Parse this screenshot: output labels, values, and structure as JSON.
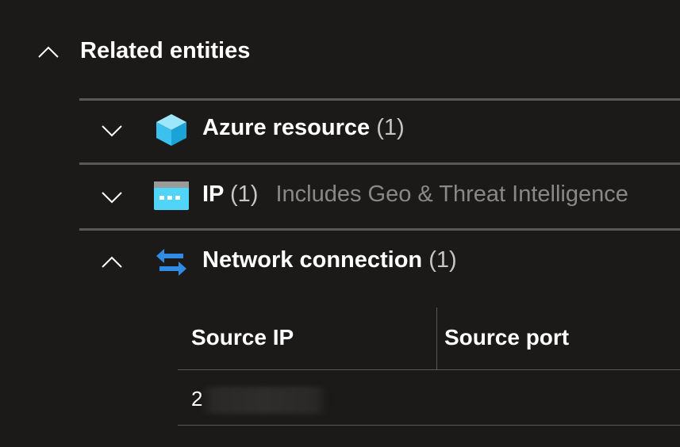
{
  "section": {
    "title": "Related entities",
    "expanded": true
  },
  "entities": [
    {
      "name": "Azure resource",
      "count": "(1)",
      "subtitle": "",
      "icon": "azure-cube-icon",
      "expanded": false
    },
    {
      "name": "IP",
      "count": "(1)",
      "subtitle": "Includes Geo & Threat Intelligence",
      "icon": "ip-window-icon",
      "expanded": false
    },
    {
      "name": "Network connection",
      "count": "(1)",
      "subtitle": "",
      "icon": "network-arrows-icon",
      "expanded": true
    }
  ],
  "network_table": {
    "columns": [
      "Source IP",
      "Source port"
    ],
    "rows": [
      {
        "source_ip_visible_prefix": "2",
        "source_port": ""
      }
    ]
  },
  "colors": {
    "background": "#1b1a19",
    "divider": "#5a5857",
    "muted_text": "#8a8886",
    "azure_blue": "#50c8f0",
    "arrow_blue": "#2f8be6"
  }
}
